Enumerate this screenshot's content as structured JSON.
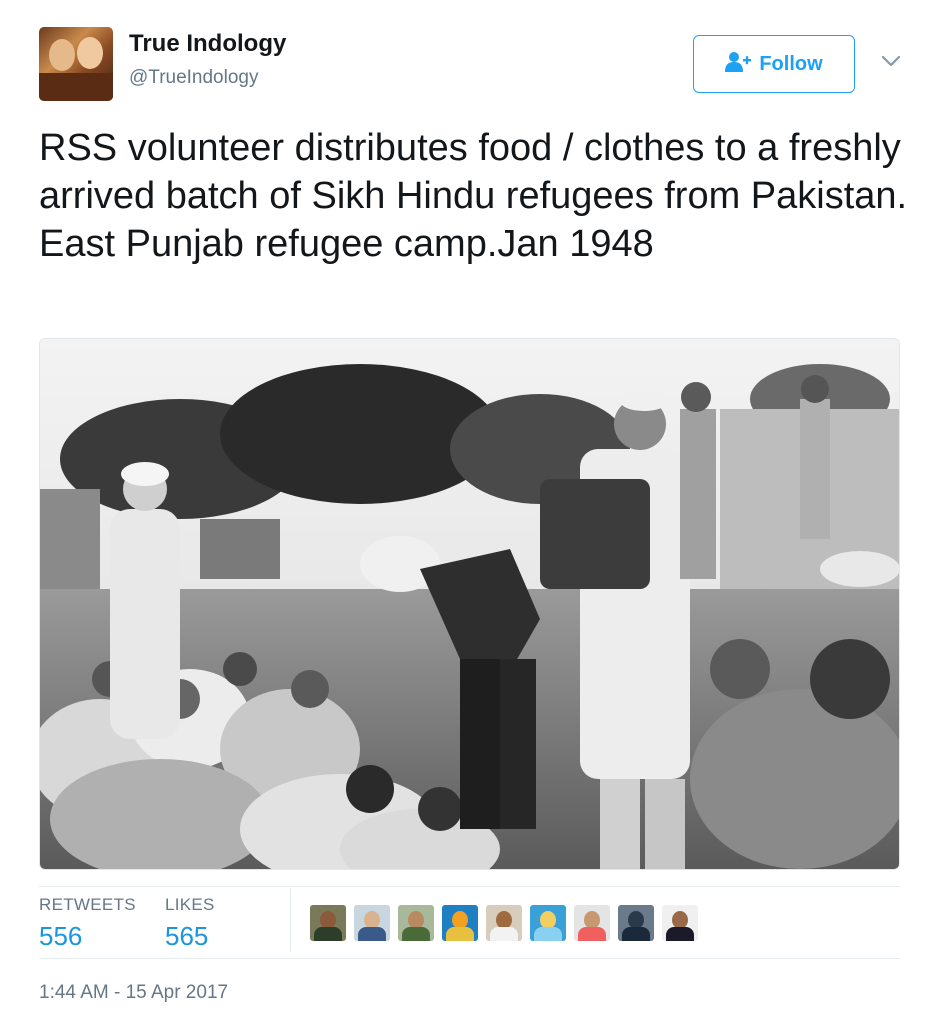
{
  "author": {
    "name": "True Indology",
    "handle": "@TrueIndology"
  },
  "follow_button": {
    "label": "Follow",
    "icon": "follow-person-plus-icon"
  },
  "menu_caret": {
    "icon": "chevron-down-icon"
  },
  "tweet": {
    "text": "RSS volunteer distributes food / clothes to a freshly  arrived batch of Sikh Hindu refugees from Pakistan. East Punjab refugee camp.Jan 1948"
  },
  "stats": {
    "retweets_label": "RETWEETS",
    "retweets_count": "556",
    "likes_label": "LIKES",
    "likes_count": "565"
  },
  "likers": [
    {
      "bg": "#7a7a5a",
      "head": "#8a5a3a",
      "body": "#2c3e2a"
    },
    {
      "bg": "#c9d6e0",
      "head": "#d8b38e",
      "body": "#3a5a8a"
    },
    {
      "bg": "#a8b89a",
      "head": "#b88a62",
      "body": "#4a6a3a"
    },
    {
      "bg": "#1e7fc2",
      "head": "#f4a020",
      "body": "#e8c040"
    },
    {
      "bg": "#d8cdbd",
      "head": "#a06a40",
      "body": "#f2f2f2"
    },
    {
      "bg": "#3aa0d8",
      "head": "#f0d060",
      "body": "#8ad0f0"
    },
    {
      "bg": "#e4e4e4",
      "head": "#c89870",
      "body": "#f06060"
    },
    {
      "bg": "#6a7a8a",
      "head": "#2a3a4a",
      "body": "#1a2a3a"
    },
    {
      "bg": "#f0f0f0",
      "head": "#9a6a48",
      "body": "#1a1a2a"
    }
  ],
  "timestamp": "1:44 AM - 15 Apr 2017",
  "colors": {
    "accent": "#1da1f2",
    "stat_value": "#1b95e0",
    "secondary_text": "#657786",
    "primary_text": "#14171a"
  }
}
